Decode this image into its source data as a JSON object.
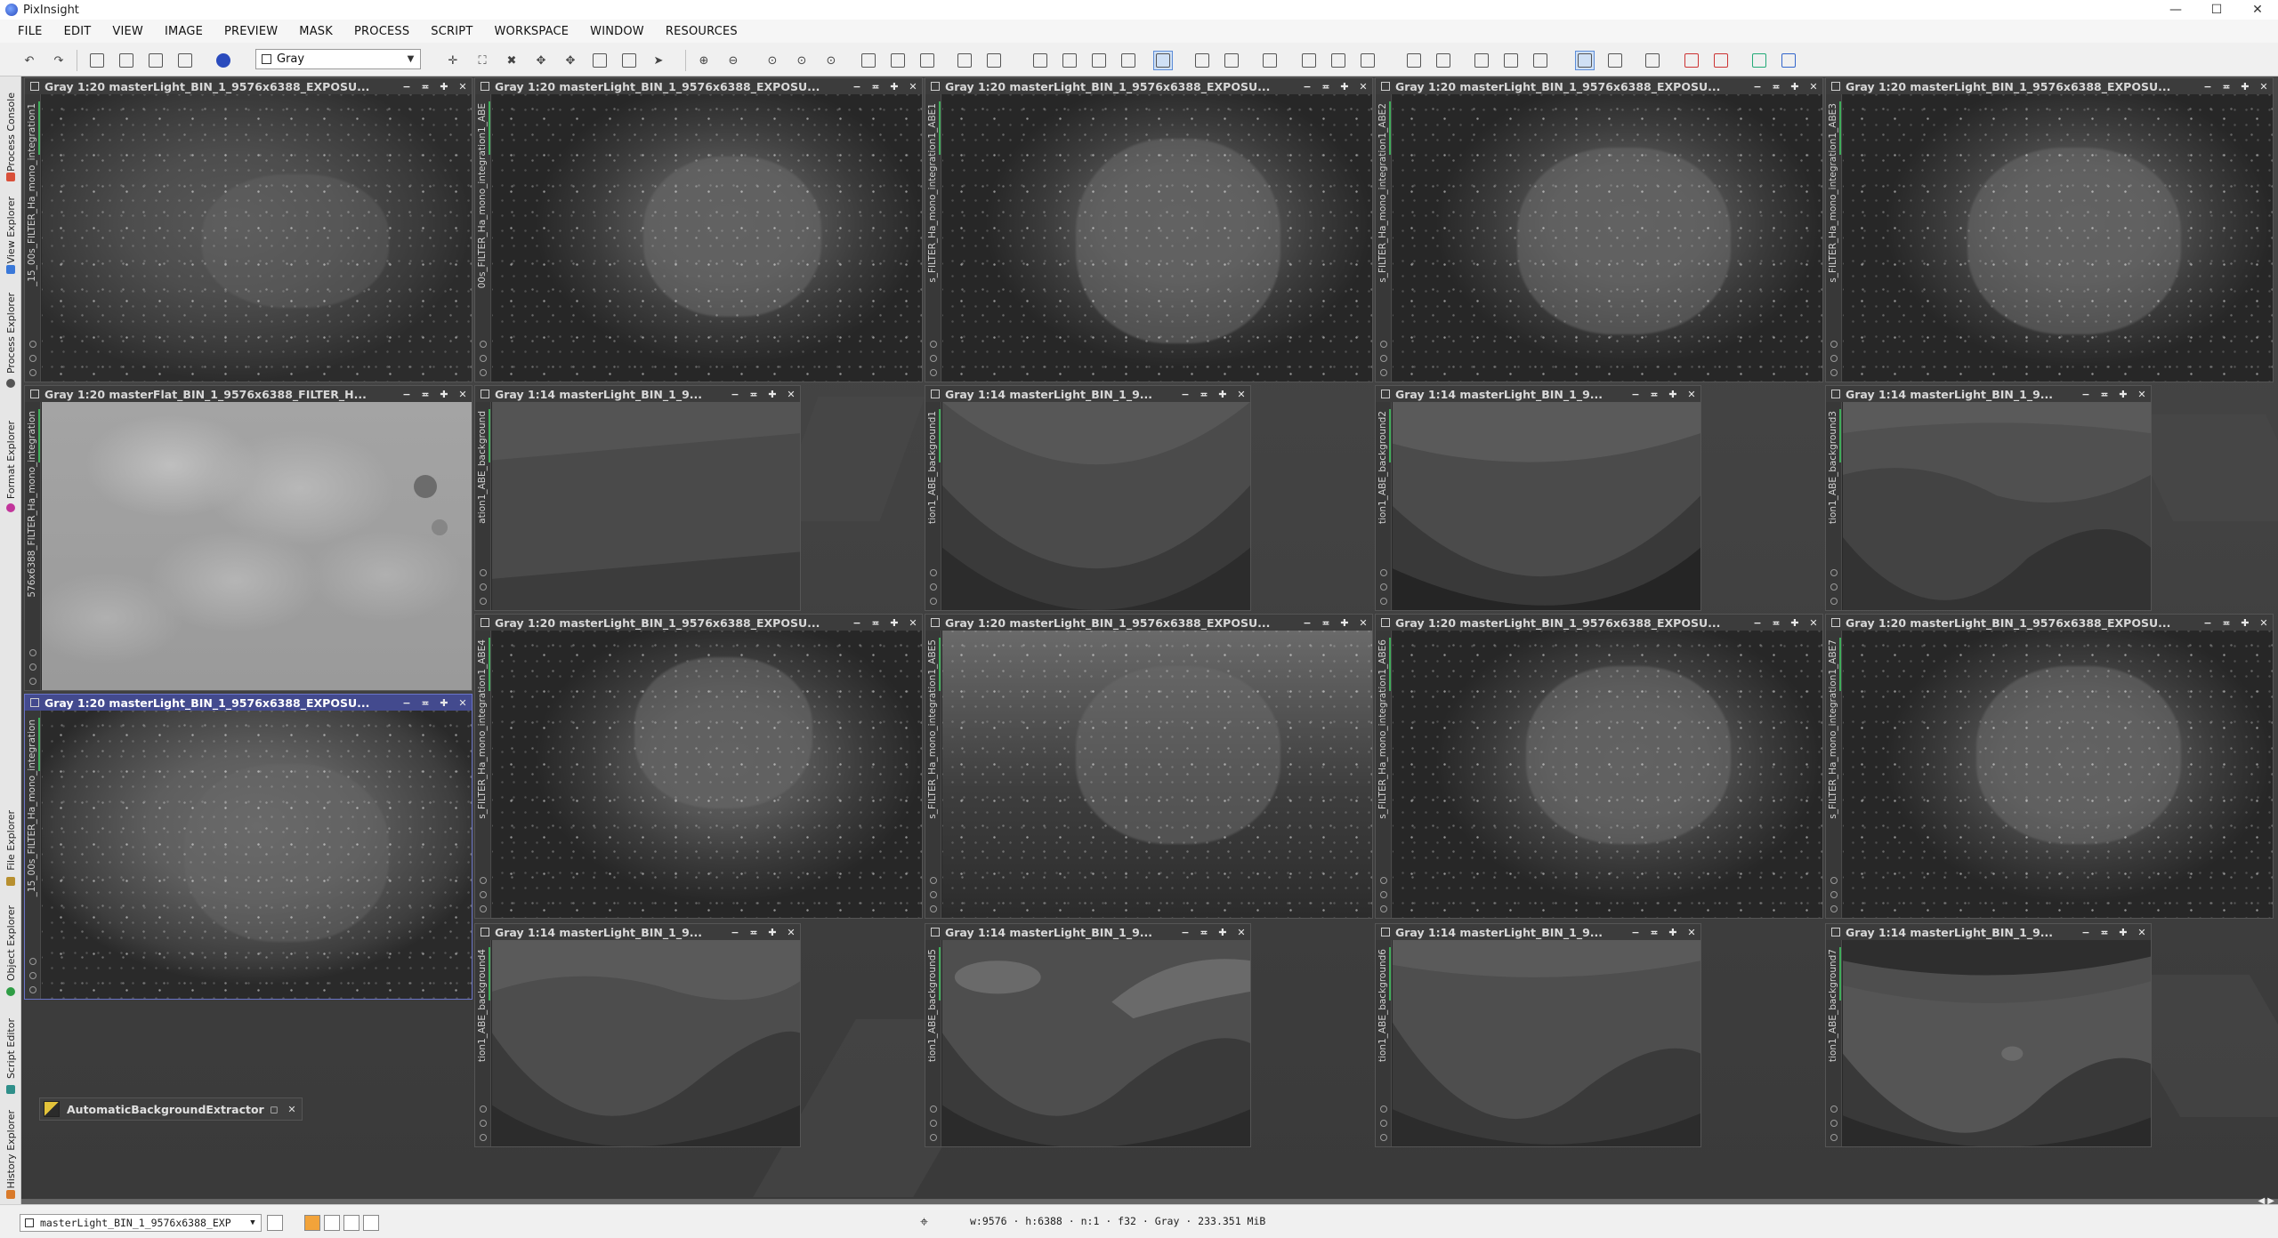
{
  "app": {
    "title": "PixInsight"
  },
  "window_controls": {
    "minimize": "—",
    "maximize": "☐",
    "close": "✕"
  },
  "menu": [
    "FILE",
    "EDIT",
    "VIEW",
    "IMAGE",
    "PREVIEW",
    "MASK",
    "PROCESS",
    "SCRIPT",
    "WORKSPACE",
    "WINDOW",
    "RESOURCES"
  ],
  "toolbar": {
    "colorspace_value": "Gray",
    "undo_icon": "undo-icon",
    "redo_icon": "redo-icon"
  },
  "side_tabs": [
    {
      "label": "Process Console",
      "icon_color": "#d9503a"
    },
    {
      "label": "View Explorer",
      "icon_color": "#3a78d9"
    },
    {
      "label": "Process Explorer",
      "icon_color": "#555555"
    },
    {
      "label": "Format Explorer",
      "icon_color": "#c2359b"
    },
    {
      "label": "File Explorer",
      "icon_color": "#b89030"
    },
    {
      "label": "Object Explorer",
      "icon_color": "#2f9d45"
    },
    {
      "label": "Script Editor",
      "icon_color": "#2f8f8a"
    },
    {
      "label": "History Explorer",
      "icon_color": "#d97a2a"
    }
  ],
  "windows": {
    "w1": {
      "title": "Gray 1:20 masterLight_BIN_1_9576x6388_EXPOSU...",
      "id_label": "_15_00s_FILTER_Ha_mono_integration1"
    },
    "w2": {
      "title": "Gray 1:20 masterLight_BIN_1_9576x6388_EXPOSU...",
      "id_label": "00s_FILTER_Ha_mono_integration1_ABE"
    },
    "w3": {
      "title": "Gray 1:20 masterLight_BIN_1_9576x6388_EXPOSU...",
      "id_label": "s_FILTER_Ha_mono_integration1_ABE1"
    },
    "w4": {
      "title": "Gray 1:20 masterLight_BIN_1_9576x6388_EXPOSU...",
      "id_label": "s_FILTER_Ha_mono_integration1_ABE2"
    },
    "w5": {
      "title": "Gray 1:20 masterLight_BIN_1_9576x6388_EXPOSU...",
      "id_label": "s_FILTER_Ha_mono_integration1_ABE3"
    },
    "flat": {
      "title": "Gray 1:20 masterFlat_BIN_1_9576x6388_FILTER_H...",
      "id_label": "576x6388_FILTER_Ha_mono_integration"
    },
    "bg0": {
      "title": "Gray 1:14 masterLight_BIN_1_9...",
      "id_label": "ation1_ABE_background"
    },
    "bg1": {
      "title": "Gray 1:14 masterLight_BIN_1_9...",
      "id_label": "tion1_ABE_background1"
    },
    "bg2": {
      "title": "Gray 1:14 masterLight_BIN_1_9...",
      "id_label": "tion1_ABE_background2"
    },
    "bg3": {
      "title": "Gray 1:14 masterLight_BIN_1_9...",
      "id_label": "tion1_ABE_background3"
    },
    "active": {
      "title": "Gray 1:20 masterLight_BIN_1_9576x6388_EXPOSU...",
      "id_label": "_15_00s_FILTER_Ha_mono_integration"
    },
    "w6": {
      "title": "Gray 1:20 masterLight_BIN_1_9576x6388_EXPOSU...",
      "id_label": "s_FILTER_Ha_mono_integration1_ABE4"
    },
    "w7": {
      "title": "Gray 1:20 masterLight_BIN_1_9576x6388_EXPOSU...",
      "id_label": "s_FILTER_Ha_mono_integration1_ABE5"
    },
    "w8": {
      "title": "Gray 1:20 masterLight_BIN_1_9576x6388_EXPOSU...",
      "id_label": "s_FILTER_Ha_mono_integration1_ABE6"
    },
    "w9": {
      "title": "Gray 1:20 masterLight_BIN_1_9576x6388_EXPOSU...",
      "id_label": "s_FILTER_Ha_mono_integration1_ABE7"
    },
    "bg4": {
      "title": "Gray 1:14 masterLight_BIN_1_9...",
      "id_label": "tion1_ABE_background4"
    },
    "bg5": {
      "title": "Gray 1:14 masterLight_BIN_1_9...",
      "id_label": "tion1_ABE_background5"
    },
    "bg6": {
      "title": "Gray 1:14 masterLight_BIN_1_9...",
      "id_label": "tion1_ABE_background6"
    },
    "bg7": {
      "title": "Gray 1:14 masterLight_BIN_1_9...",
      "id_label": "tion1_ABE_background7"
    }
  },
  "win_ctrls": {
    "minimize": "−",
    "shade": "≖",
    "maximize": "✚",
    "close": "✕"
  },
  "process_icon": {
    "label": "AutomaticBackgroundExtractor"
  },
  "statusbar": {
    "view_selector": "masterLight_BIN_1_9576x6388_EXP",
    "image_info": "w:9576 · h:6388 · n:1 · f32 · Gray · 233.351 MiB"
  },
  "colors": {
    "active_window_title": "#434a8e",
    "mask_indicator": "#3fae5a"
  }
}
